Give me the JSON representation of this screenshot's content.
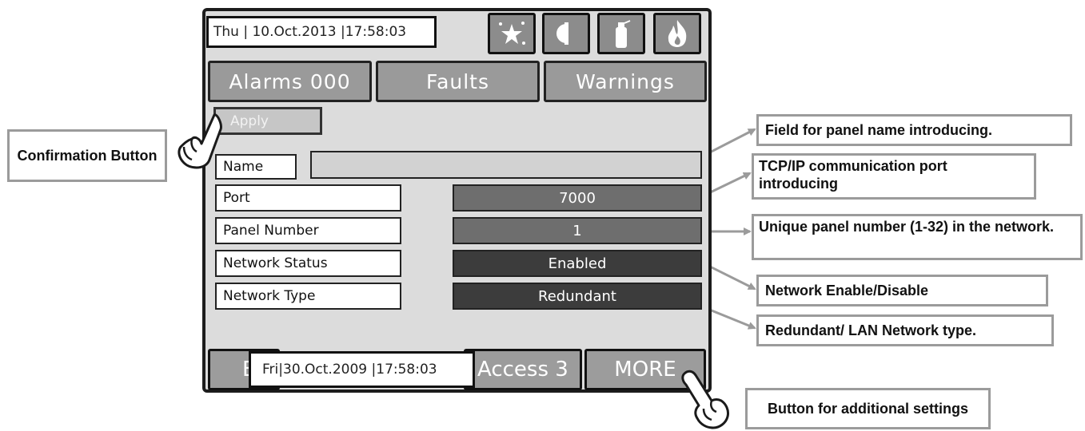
{
  "datetime": {
    "day": "Thu",
    "date": "10.Oct.2013",
    "time": "17:58:03"
  },
  "icons": [
    "sparkle-star-icon",
    "half-circle-icon",
    "extinguisher-icon",
    "fire-icon"
  ],
  "tabs": {
    "alarms": "Alarms 000",
    "faults": "Faults",
    "warnings": "Warnings"
  },
  "apply_label": "Apply",
  "fields": {
    "name_label": "Name",
    "port_label": "Port",
    "port_value": "7000",
    "panel_number_label": "Panel Number",
    "panel_number_value": "1",
    "network_status_label": "Network Status",
    "network_status_value": "Enabled",
    "network_type_label": "Network Type",
    "network_type_value": "Redundant"
  },
  "bottom": {
    "left_partial": "E",
    "access_label": "Access 3",
    "more_label": "MORE",
    "clock_day": "Fri",
    "clock_date": "30.Oct.2009",
    "clock_time": "17:58:03"
  },
  "callouts": {
    "confirm": "Confirmation Button",
    "name": "Field for panel name introducing.",
    "port": "TCP/IP communication port introducing",
    "panel_number": "Unique panel number (1-32) in the network.",
    "network_status": "Network Enable/Disable",
    "network_type": "Redundant/ LAN Network type.",
    "more": "Button for additional settings"
  },
  "colors": {
    "panel_bg": "#dcdcdc",
    "button_gray": "#9a9a9a",
    "value_medium": "#6e6e6e",
    "value_dark": "#3c3c3c",
    "callout_border": "#9b9b9b"
  }
}
